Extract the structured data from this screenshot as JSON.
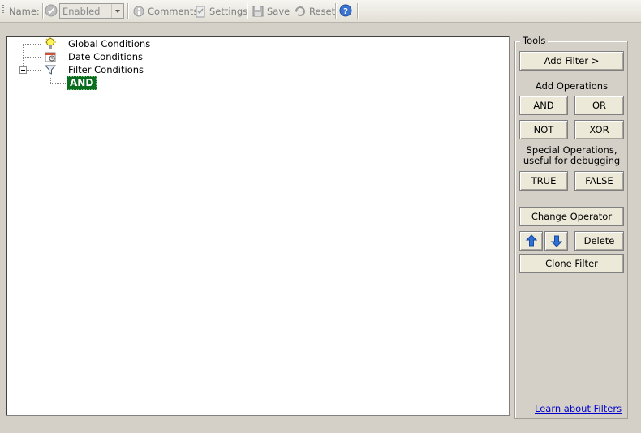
{
  "toolbar": {
    "name_label": "Name:",
    "status_value": "Enabled",
    "comments_label": "Comments",
    "settings_label": "Settings",
    "save_label": "Save",
    "reset_label": "Reset"
  },
  "tree": {
    "nodes": [
      {
        "label": "Global Conditions",
        "icon": "lightbulb-icon"
      },
      {
        "label": "Date Conditions",
        "icon": "calendar-icon"
      },
      {
        "label": "Filter Conditions",
        "icon": "filter-funnel-icon"
      }
    ],
    "operator_node": "AND"
  },
  "tools": {
    "title": "Tools",
    "add_filter_label": "Add Filter >",
    "add_operations_label": "Add Operations",
    "and_label": "AND",
    "or_label": "OR",
    "not_label": "NOT",
    "xor_label": "XOR",
    "special_operations_label": "Special Operations, useful for debugging",
    "true_label": "TRUE",
    "false_label": "FALSE",
    "change_operator_label": "Change Operator",
    "delete_label": "Delete",
    "clone_filter_label": "Clone Filter",
    "learn_link": "Learn about Filters"
  },
  "colors": {
    "and_node_bg": "#0b6e1f",
    "link": "#0000cc",
    "arrow_blue": "#2f6fd6"
  }
}
